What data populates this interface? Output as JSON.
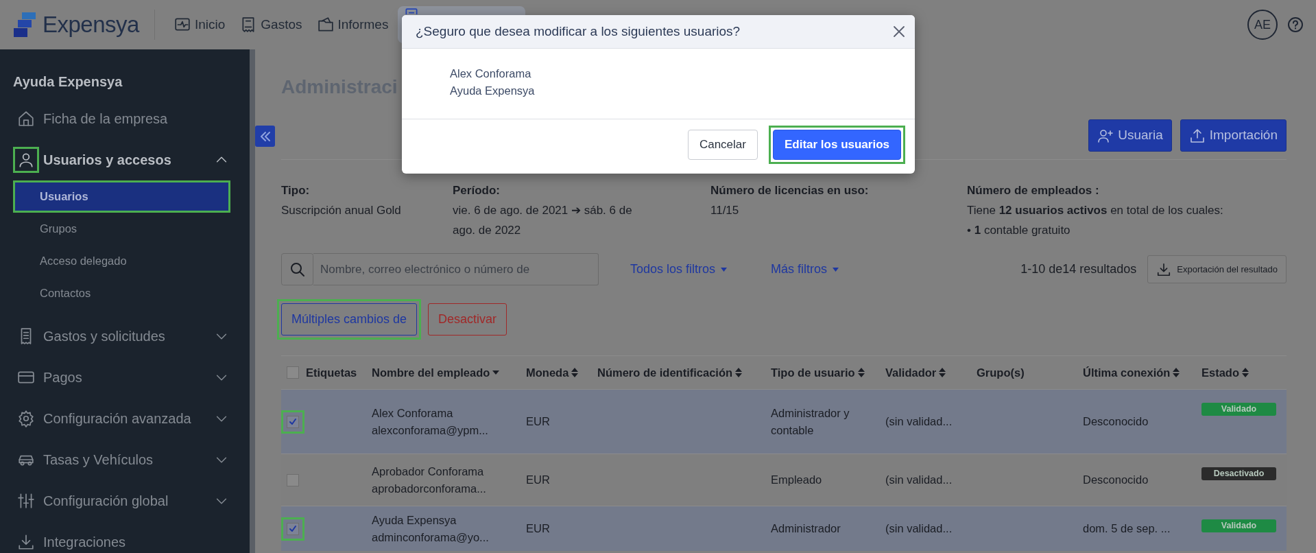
{
  "app": {
    "brand": "Expensya",
    "avatar": "AE"
  },
  "top_nav": [
    {
      "label": "Inicio",
      "selected": false
    },
    {
      "label": "Gastos",
      "selected": false
    },
    {
      "label": "Informes",
      "selected": false
    },
    {
      "selected": true
    }
  ],
  "sidebar": {
    "title": "Ayuda Expensya",
    "items": [
      {
        "label": "Ficha de la empresa",
        "kind": "link"
      },
      {
        "label": "Usuarios y accesos",
        "kind": "group",
        "expanded": true,
        "highlighted": true,
        "children": [
          {
            "label": "Usuarios",
            "selected": true,
            "highlighted": true
          },
          {
            "label": "Grupos",
            "selected": false,
            "highlighted": false
          },
          {
            "label": "Acceso delegado",
            "selected": false,
            "highlighted": false
          },
          {
            "label": "Contactos",
            "selected": false,
            "highlighted": false
          }
        ]
      },
      {
        "label": "Gastos y solicitudes",
        "kind": "group",
        "expanded": false,
        "highlighted": false
      },
      {
        "label": "Pagos",
        "kind": "group",
        "expanded": false,
        "highlighted": false
      },
      {
        "label": "Configuración avanzada",
        "kind": "group",
        "expanded": false,
        "highlighted": false
      },
      {
        "label": "Tasas y Vehículos",
        "kind": "group",
        "expanded": false,
        "highlighted": false
      },
      {
        "label": "Configuración global",
        "kind": "group",
        "expanded": false,
        "highlighted": false
      },
      {
        "label": "Integraciones",
        "kind": "link"
      }
    ]
  },
  "page": {
    "title": "Administraci",
    "actions": [
      "Usuaria",
      "Importación"
    ]
  },
  "summary": [
    {
      "label": "Tipo:",
      "value": "Suscripción anual Gold"
    },
    {
      "label": "Período:",
      "value": "vie. 6 de ago. de 2021 ➔ sáb. 6 de ago. de 2022"
    },
    {
      "label": "Número de licencias en uso:",
      "value": "11/15"
    },
    {
      "label": "Número de empleados :",
      "value": "Tiene **12 usuarios activos** en total de los cuales:",
      "note": "• **1** contable gratuito"
    }
  ],
  "filters": {
    "search": {
      "placeholder": "Nombre, correo electrónico o número de"
    },
    "dropdowns": [
      "Todos los filtros",
      "Más filtros"
    ],
    "results": "1-10 de14 resultados",
    "export": "Exportación del resultado"
  },
  "bulk_actions": [
    {
      "label": "Múltiples cambios de",
      "kind": "primary",
      "highlighted": true
    },
    {
      "label": "Desactivar",
      "kind": "danger",
      "highlighted": false
    }
  ],
  "table": {
    "all_selected": false,
    "columns": [
      {
        "label": "Etiquetas",
        "sortable": false
      },
      {
        "label": "Nombre del empleado",
        "sortable": true,
        "sorted": true
      },
      {
        "label": "Moneda",
        "sortable": true,
        "sorted": false
      },
      {
        "label": "Número de identificación",
        "sortable": true,
        "sorted": false
      },
      {
        "label": "Tipo de usuario",
        "sortable": true,
        "sorted": false
      },
      {
        "label": "Validador",
        "sortable": true,
        "sorted": false
      },
      {
        "label": "Grupo(s)",
        "sortable": false
      },
      {
        "label": "Última conexión",
        "sortable": true,
        "sorted": false
      },
      {
        "label": "Estado",
        "sortable": true,
        "sorted": false
      }
    ],
    "rows": [
      {
        "selected": true,
        "highlighted": true,
        "name": "Alex Conforama",
        "email": "alexconforama@ypm...",
        "currency": "EUR",
        "user_type": "Administrador y contable",
        "validator": "(sin validad...",
        "last_login": "Desconocido",
        "status": {
          "label": "Validado",
          "color": "#1e8a44"
        }
      },
      {
        "selected": false,
        "highlighted": false,
        "name": "Aprobador Conforama",
        "email": "aprobadorconforama...",
        "currency": "EUR",
        "user_type": "Empleado",
        "validator": "(sin validad...",
        "last_login": "Desconocido",
        "status": {
          "label": "Desactivado",
          "color": "#2b2b2b"
        }
      },
      {
        "selected": true,
        "highlighted": true,
        "name": "Ayuda Expensya",
        "email": "adminconforama@yo...",
        "currency": "EUR",
        "user_type": "Administrador",
        "validator": "(sin validad...",
        "last_login": "dom. 5 de sep. ...",
        "status": {
          "label": "Validado",
          "color": "#1e8a44"
        }
      }
    ]
  },
  "modal": {
    "title": "¿Seguro que desea modificar a los siguientes usuarios?",
    "users": [
      "Alex Conforama",
      "Ayuda Expensya"
    ],
    "buttons": [
      {
        "label": "Cancelar",
        "kind": "secondary",
        "highlighted": false
      },
      {
        "label": "Editar los usuarios",
        "kind": "primary",
        "highlighted": true
      }
    ]
  }
}
